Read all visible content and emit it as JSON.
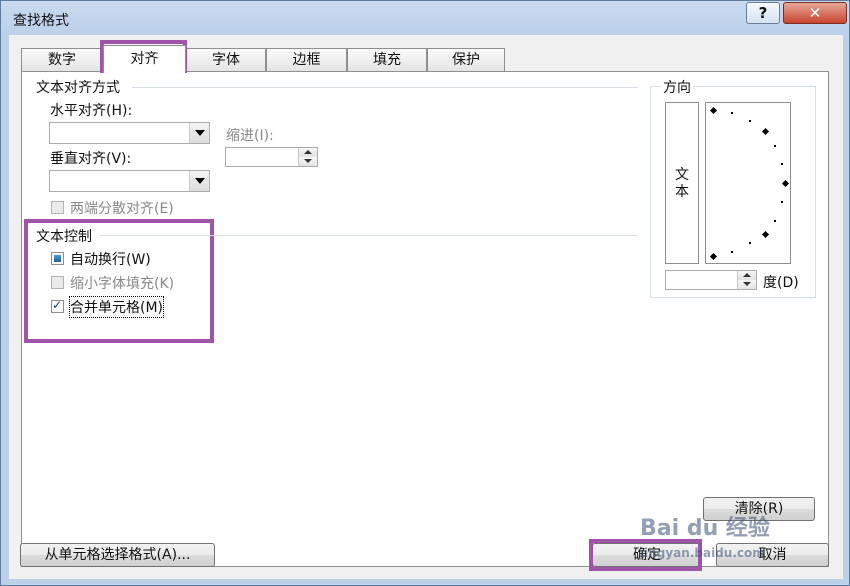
{
  "window": {
    "title": "查找格式",
    "help_label": "?",
    "close_label": "✕"
  },
  "tabs": [
    {
      "label": "数字"
    },
    {
      "label": "对齐"
    },
    {
      "label": "字体"
    },
    {
      "label": "边框"
    },
    {
      "label": "填充"
    },
    {
      "label": "保护"
    }
  ],
  "alignment": {
    "group_title": "文本对齐方式",
    "horizontal_label": "水平对齐(H):",
    "horizontal_value": "",
    "vertical_label": "垂直对齐(V):",
    "vertical_value": "",
    "indent_label": "缩进(I):",
    "indent_value": "",
    "justify_distributed_label": "两端分散对齐(E)"
  },
  "text_control": {
    "group_title": "文本控制",
    "wrap_text_label": "自动换行(W)",
    "shrink_to_fit_label": "缩小字体填充(K)",
    "merge_cells_label": "合并单元格(M)"
  },
  "orientation": {
    "group_title": "方向",
    "vertical_text": "文本",
    "degrees_value": "",
    "degrees_label": "度(D)"
  },
  "buttons": {
    "clear": "清除(R)",
    "choose_from_cell": "从单元格选择格式(A)...",
    "ok": "确定",
    "cancel": "取消"
  },
  "watermark": {
    "brand": "Bai du 经验",
    "url": "jingyan.baidu.com"
  },
  "colors": {
    "highlight": "#9f54a8",
    "checkbox_fill": "#1d5f95"
  }
}
